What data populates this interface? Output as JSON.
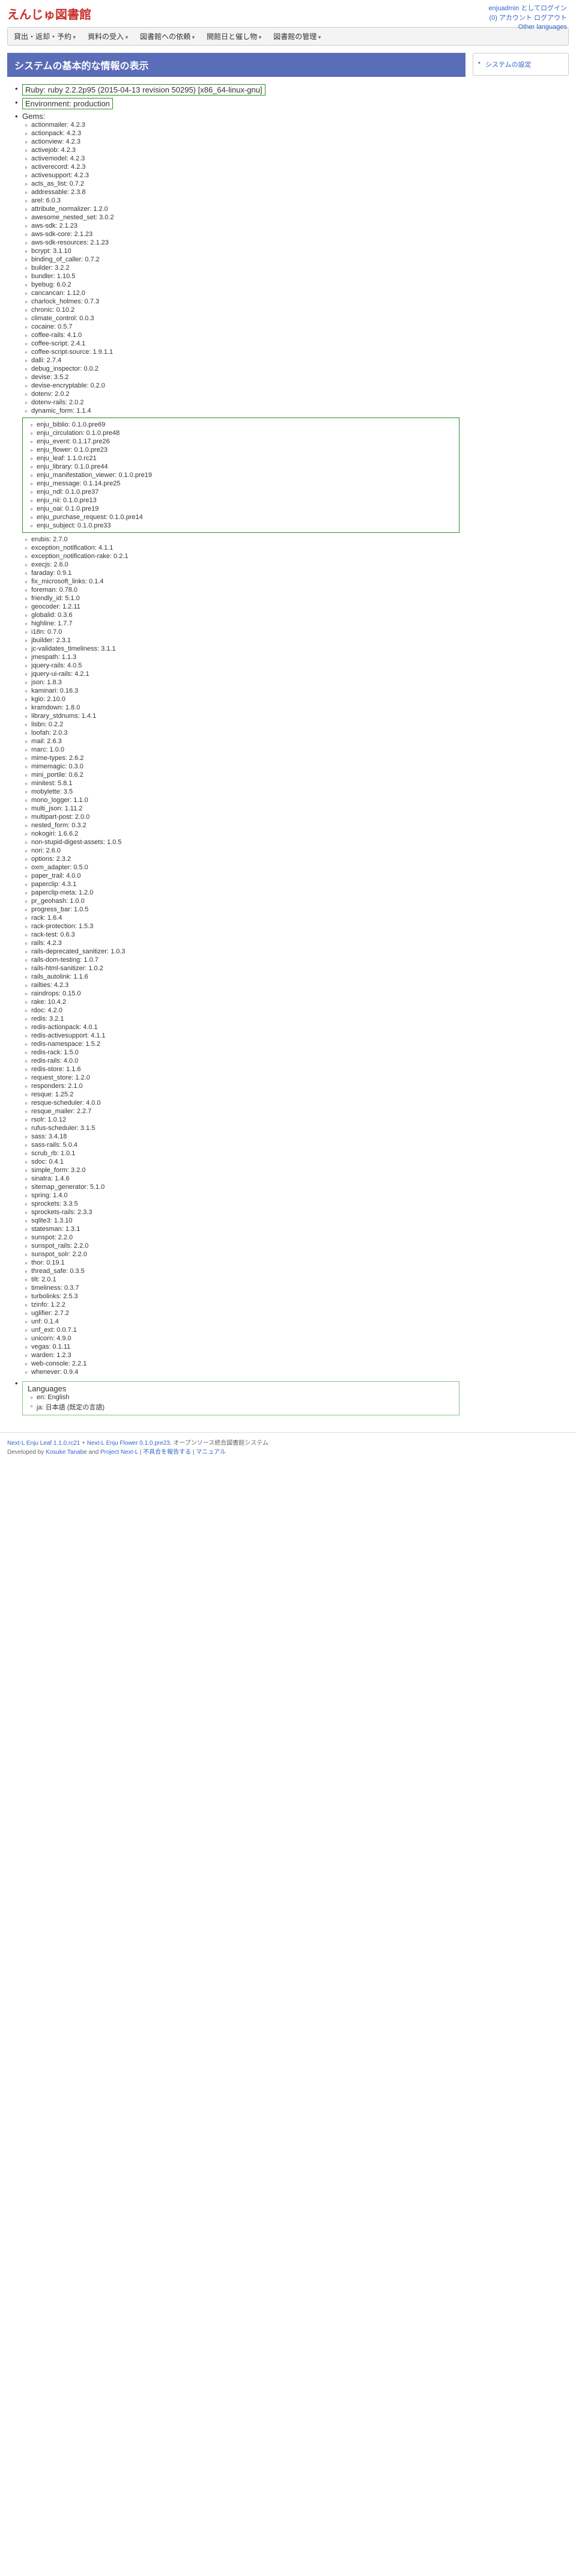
{
  "site_title": "えんじゅ図書館",
  "top_links": {
    "login_as": "enjuadmin としてログイン",
    "account": "(0) アカウント ログアウト",
    "other_lang": "Other languages"
  },
  "nav": [
    "貸出・返却・予約",
    "資料の受入",
    "図書館への依頼",
    "開館日と催し物",
    "図書館の管理"
  ],
  "sidebar": {
    "items": [
      "システムの設定"
    ]
  },
  "page_title": "システムの基本的な情報の表示",
  "ruby_line": "Ruby: ruby 2.2.2p95 (2015-04-13 revision 50295) [x86_64-linux-gnu]",
  "env_line": "Environment: production",
  "gems_label": "Gems:",
  "gems_pre": [
    "actionmailer: 4.2.3",
    "actionpack: 4.2.3",
    "actionview: 4.2.3",
    "activejob: 4.2.3",
    "activemodel: 4.2.3",
    "activerecord: 4.2.3",
    "activesupport: 4.2.3",
    "acts_as_list: 0.7.2",
    "addressable: 2.3.8",
    "arel: 6.0.3",
    "attribute_normalizer: 1.2.0",
    "awesome_nested_set: 3.0.2",
    "aws-sdk: 2.1.23",
    "aws-sdk-core: 2.1.23",
    "aws-sdk-resources: 2.1.23",
    "bcrypt: 3.1.10",
    "binding_of_caller: 0.7.2",
    "builder: 3.2.2",
    "bundler: 1.10.5",
    "byebug: 6.0.2",
    "cancancan: 1.12.0",
    "charlock_holmes: 0.7.3",
    "chronic: 0.10.2",
    "climate_control: 0.0.3",
    "cocaine: 0.5.7",
    "coffee-rails: 4.1.0",
    "coffee-script: 2.4.1",
    "coffee-script-source: 1.9.1.1",
    "dalli: 2.7.4",
    "debug_inspector: 0.0.2",
    "devise: 3.5.2",
    "devise-encryptable: 0.2.0",
    "dotenv: 2.0.2",
    "dotenv-rails: 2.0.2",
    "dynamic_form: 1.1.4"
  ],
  "gems_enju": [
    "enju_biblio: 0.1.0.pre69",
    "enju_circulation: 0.1.0.pre48",
    "enju_event: 0.1.17.pre26",
    "enju_flower: 0.1.0.pre23",
    "enju_leaf: 1.1.0.rc21",
    "enju_library: 0.1.0.pre44",
    "enju_manifestation_viewer: 0.1.0.pre19",
    "enju_message: 0.1.14.pre25",
    "enju_ndl: 0.1.0.pre37",
    "enju_nii: 0.1.0.pre13",
    "enju_oai: 0.1.0.pre19",
    "enju_purchase_request: 0.1.0.pre14",
    "enju_subject: 0.1.0.pre33"
  ],
  "gems_post": [
    "erubis: 2.7.0",
    "exception_notification: 4.1.1",
    "exception_notification-rake: 0.2.1",
    "execjs: 2.6.0",
    "faraday: 0.9.1",
    "fix_microsoft_links: 0.1.4",
    "foreman: 0.78.0",
    "friendly_id: 5.1.0",
    "geocoder: 1.2.11",
    "globalid: 0.3.6",
    "highline: 1.7.7",
    "i18n: 0.7.0",
    "jbuilder: 2.3.1",
    "jc-validates_timeliness: 3.1.1",
    "jmespath: 1.1.3",
    "jquery-rails: 4.0.5",
    "jquery-ui-rails: 4.2.1",
    "json: 1.8.3",
    "kaminari: 0.16.3",
    "kgio: 2.10.0",
    "kramdown: 1.8.0",
    "library_stdnums: 1.4.1",
    "lisbn: 0.2.2",
    "loofah: 2.0.3",
    "mail: 2.6.3",
    "marc: 1.0.0",
    "mime-types: 2.6.2",
    "mimemagic: 0.3.0",
    "mini_portile: 0.6.2",
    "minitest: 5.8.1",
    "mobylette: 3.5",
    "mono_logger: 1.1.0",
    "multi_json: 1.11.2",
    "multipart-post: 2.0.0",
    "nested_form: 0.3.2",
    "nokogiri: 1.6.6.2",
    "non-stupid-digest-assets: 1.0.5",
    "nori: 2.6.0",
    "options: 2.3.2",
    "oxm_adapter: 0.5.0",
    "paper_trail: 4.0.0",
    "paperclip: 4.3.1",
    "paperclip-meta: 1.2.0",
    "pr_geohash: 1.0.0",
    "progress_bar: 1.0.5",
    "rack: 1.6.4",
    "rack-protection: 1.5.3",
    "rack-test: 0.6.3",
    "rails: 4.2.3",
    "rails-deprecated_sanitizer: 1.0.3",
    "rails-dom-testing: 1.0.7",
    "rails-html-sanitizer: 1.0.2",
    "rails_autolink: 1.1.6",
    "railties: 4.2.3",
    "raindrops: 0.15.0",
    "rake: 10.4.2",
    "rdoc: 4.2.0",
    "redis: 3.2.1",
    "redis-actionpack: 4.0.1",
    "redis-activesupport: 4.1.1",
    "redis-namespace: 1.5.2",
    "redis-rack: 1.5.0",
    "redis-rails: 4.0.0",
    "redis-store: 1.1.6",
    "request_store: 1.2.0",
    "responders: 2.1.0",
    "resque: 1.25.2",
    "resque-scheduler: 4.0.0",
    "resque_mailer: 2.2.7",
    "rsolr: 1.0.12",
    "rufus-scheduler: 3.1.5",
    "sass: 3.4.18",
    "sass-rails: 5.0.4",
    "scrub_rb: 1.0.1",
    "sdoc: 0.4.1",
    "simple_form: 3.2.0",
    "sinatra: 1.4.6",
    "sitemap_generator: 5.1.0",
    "spring: 1.4.0",
    "sprockets: 3.3.5",
    "sprockets-rails: 2.3.3",
    "sqlite3: 1.3.10",
    "statesman: 1.3.1",
    "sunspot: 2.2.0",
    "sunspot_rails: 2.2.0",
    "sunspot_solr: 2.2.0",
    "thor: 0.19.1",
    "thread_safe: 0.3.5",
    "tilt: 2.0.1",
    "timeliness: 0.3.7",
    "turbolinks: 2.5.3",
    "tzinfo: 1.2.2",
    "uglifier: 2.7.2",
    "unf: 0.1.4",
    "unf_ext: 0.0.7.1",
    "unicorn: 4.9.0",
    "vegas: 0.1.11",
    "warden: 1.2.3",
    "web-console: 2.2.1",
    "whenever: 0.9.4"
  ],
  "languages_label": "Languages",
  "languages": [
    "en: English",
    "ja: 日本語 (既定の言語)"
  ],
  "footer": {
    "link1": "Next-L Enju Leaf 1.1.0.rc21",
    "plus": " + ",
    "link2": "Next-L Enju Flower 0.1.0.pre23",
    "text": ", オープンソース統合図書館システム",
    "dev": "Developed by ",
    "dev1": "Kosuke Tanabe",
    "and": " and ",
    "dev2": "Project Next-L",
    "sep": " | ",
    "bug": "不具合を報告する",
    "manual": "マニュアル"
  }
}
